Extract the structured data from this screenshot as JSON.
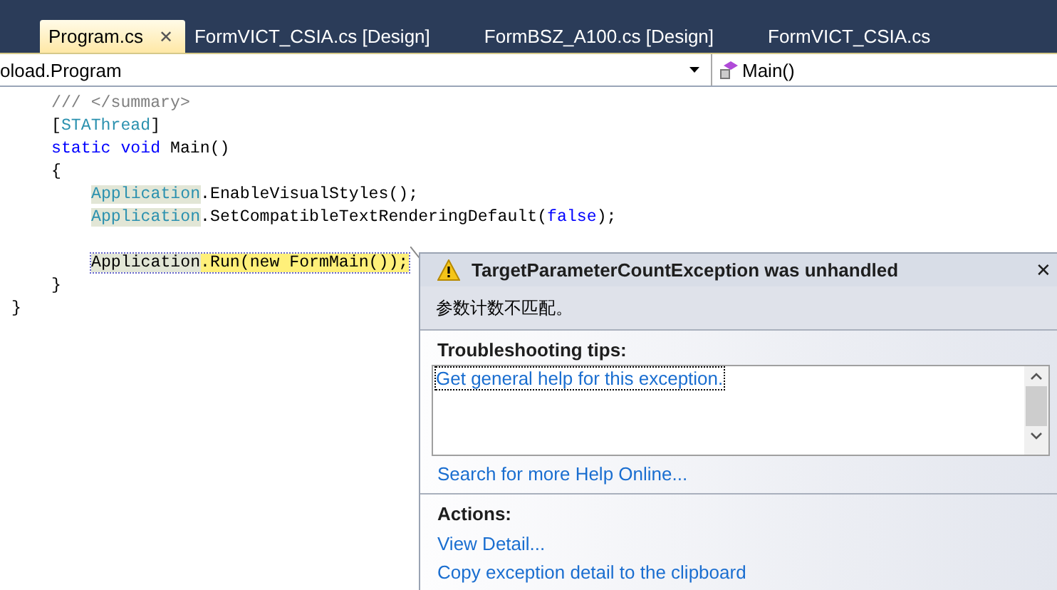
{
  "tabs": [
    {
      "label": "Program.cs",
      "selected": true,
      "close": "✕"
    },
    {
      "label": "FormVICT_CSIA.cs [Design]",
      "selected": false
    },
    {
      "label": "FormBSZ_A100.cs [Design]",
      "selected": false
    },
    {
      "label": "FormVICT_CSIA.cs",
      "selected": false
    }
  ],
  "navigation": {
    "type_combo": "oload.Program",
    "member_combo": "Main()"
  },
  "code_lines": [
    {
      "kind": "member",
      "tokens": [
        {
          "text": "/// </summary>",
          "kind": "comment"
        }
      ]
    },
    {
      "kind": "member",
      "tokens": [
        {
          "text": "[",
          "kind": "plain"
        },
        {
          "text": "STAThread",
          "kind": "type"
        },
        {
          "text": "]",
          "kind": "plain"
        }
      ]
    },
    {
      "kind": "member",
      "tokens": [
        {
          "text": "static void",
          "kind": "keyword"
        },
        {
          "text": " Main()",
          "kind": "plain"
        }
      ]
    },
    {
      "kind": "member",
      "tokens": [
        {
          "text": "{",
          "kind": "plain"
        }
      ]
    },
    {
      "kind": "statement",
      "tokens": [
        {
          "text": "Application",
          "kind": "type",
          "highlighted": true
        },
        {
          "text": ".EnableVisualStyles();",
          "kind": "plain"
        }
      ]
    },
    {
      "kind": "statement",
      "tokens": [
        {
          "text": "Application",
          "kind": "type",
          "highlighted": true
        },
        {
          "text": ".SetCompatibleTextRenderingDefault(",
          "kind": "plain"
        },
        {
          "text": "false",
          "kind": "keyword"
        },
        {
          "text": ");",
          "kind": "plain"
        }
      ]
    },
    {
      "kind": "blank"
    },
    {
      "kind": "statement",
      "current": true,
      "tokens": [
        {
          "text": "Application",
          "kind": "plain",
          "highlighted": true
        },
        {
          "text": ".Run(new FormMain());",
          "kind": "plain",
          "current": true
        }
      ]
    },
    {
      "kind": "member",
      "tokens": [
        {
          "text": "}",
          "kind": "plain"
        }
      ]
    },
    {
      "kind": "type",
      "tokens": [
        {
          "text": "}",
          "kind": "plain"
        }
      ]
    }
  ],
  "exception": {
    "title": "TargetParameterCountException was unhandled",
    "close": "✕",
    "message": "参数计数不匹配。",
    "tips_heading": "Troubleshooting tips:",
    "tips": [
      "Get general help for this exception."
    ],
    "search_link": "Search for more Help Online...",
    "actions_heading": "Actions:",
    "actions": [
      "View Detail...",
      "Copy exception detail to the clipboard"
    ]
  }
}
